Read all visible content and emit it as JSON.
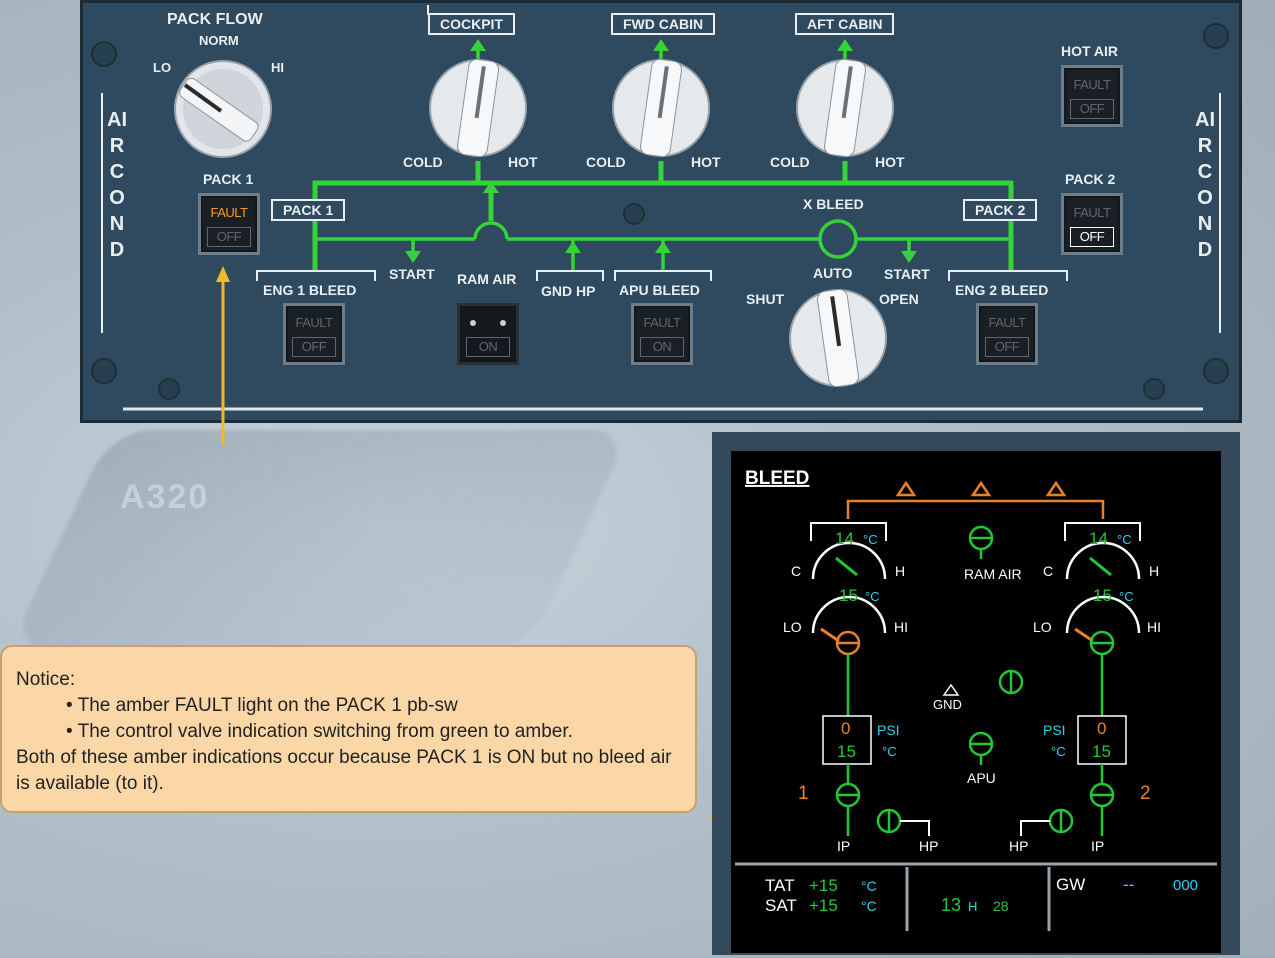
{
  "overhead": {
    "side_label_left": "AIR COND",
    "side_label_right": "AIR COND",
    "pack_flow": {
      "title": "PACK FLOW",
      "norm": "NORM",
      "lo": "LO",
      "hi": "HI"
    },
    "cockpit": {
      "title": "COCKPIT",
      "cold": "COLD",
      "hot": "HOT"
    },
    "fwd_cabin": {
      "title": "FWD CABIN",
      "cold": "COLD",
      "hot": "HOT"
    },
    "aft_cabin": {
      "title": "AFT CABIN",
      "cold": "COLD",
      "hot": "HOT"
    },
    "hot_air": {
      "title": "HOT AIR",
      "top": "FAULT",
      "bottom": "OFF"
    },
    "pack1": {
      "title": "PACK 1",
      "top": "FAULT",
      "bottom": "OFF",
      "duct_label": "PACK 1"
    },
    "pack2": {
      "title": "PACK 2",
      "top": "FAULT",
      "bottom": "OFF",
      "duct_label": "PACK 2"
    },
    "eng1_bleed": {
      "title": "ENG 1 BLEED",
      "top": "FAULT",
      "bottom": "OFF"
    },
    "eng2_bleed": {
      "title": "ENG 2 BLEED",
      "top": "FAULT",
      "bottom": "OFF"
    },
    "ram_air": {
      "title": "RAM AIR",
      "bottom": "ON"
    },
    "gnd_hp": "GND HP",
    "apu_bleed": {
      "title": "APU BLEED",
      "top": "FAULT",
      "bottom": "ON"
    },
    "start_left": "START",
    "start_right": "START",
    "x_bleed": {
      "title": "X BLEED",
      "auto": "AUTO",
      "shut": "SHUT",
      "open": "OPEN"
    },
    "colors": {
      "panel": "#2f4a5e",
      "flow_line": "#35d23a",
      "amber": "#ff9a1f"
    }
  },
  "ecam": {
    "title": "BLEED",
    "left": {
      "comp_temp": "14",
      "comp_unit": "°C",
      "pack_temp": "15",
      "pack_unit": "°C",
      "c": "C",
      "h": "H",
      "lo": "LO",
      "hi": "HI",
      "psi_value": "0",
      "psi_label": "PSI",
      "bleed_temp": "15",
      "bleed_unit": "°C",
      "engine_number": "1",
      "ip": "IP",
      "hp": "HP"
    },
    "right": {
      "comp_temp": "14",
      "comp_unit": "°C",
      "pack_temp": "15",
      "pack_unit": "°C",
      "c": "C",
      "h": "H",
      "lo": "LO",
      "hi": "HI",
      "psi_value": "0",
      "psi_label": "PSI",
      "bleed_temp": "15",
      "bleed_unit": "°C",
      "engine_number": "2",
      "ip": "IP",
      "hp": "HP"
    },
    "ram_air": "RAM AIR",
    "gnd": "GND",
    "apu": "APU",
    "footer": {
      "tat_label": "TAT",
      "tat_value": "+15",
      "tat_unit": "°C",
      "sat_label": "SAT",
      "sat_value": "+15",
      "sat_unit": "°C",
      "time_h": "13",
      "time_sep": "H",
      "time_m": "28",
      "gw_label": "GW",
      "gw_value": "--",
      "gw_unit": "000"
    },
    "colors": {
      "green": "#23c837",
      "amber": "#e8822a",
      "cyan": "#2bd4f0",
      "white": "#ffffff"
    }
  },
  "notice": {
    "heading": "Notice:",
    "bullets": [
      "The amber FAULT light  on the PACK 1 pb-sw",
      "The control valve indication switching from green to amber."
    ],
    "body": "Both of these amber indications occur because PACK 1 is ON but no bleed air is available (to it)."
  },
  "background_text": "A320"
}
